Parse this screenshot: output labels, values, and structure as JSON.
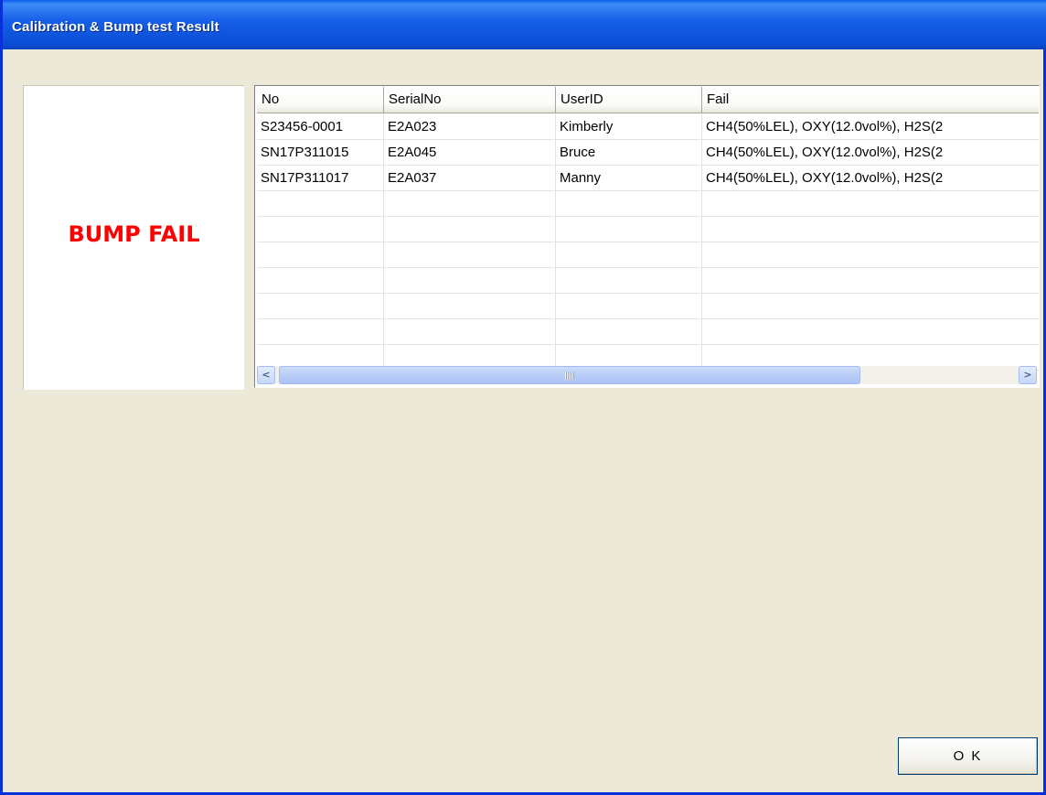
{
  "window": {
    "title": "Calibration & Bump test Result"
  },
  "status": {
    "label": "BUMP FAIL",
    "color": "#FF0000"
  },
  "table": {
    "columns": [
      "No",
      "SerialNo",
      "UserID",
      "Fail"
    ],
    "rows": [
      [
        "S23456-0001",
        "E2A023",
        "Kimberly",
        "CH4(50%LEL), OXY(12.0vol%), H2S(2"
      ],
      [
        "SN17P311015",
        "E2A045",
        "Bruce",
        "CH4(50%LEL), OXY(12.0vol%), H2S(2"
      ],
      [
        "SN17P311017",
        "E2A037",
        "Manny",
        "CH4(50%LEL), OXY(12.0vol%), H2S(2"
      ],
      [
        "",
        "",
        "",
        ""
      ],
      [
        "",
        "",
        "",
        ""
      ],
      [
        "",
        "",
        "",
        ""
      ],
      [
        "",
        "",
        "",
        ""
      ],
      [
        "",
        "",
        "",
        ""
      ],
      [
        "",
        "",
        "",
        ""
      ],
      [
        "",
        "",
        "",
        ""
      ]
    ]
  },
  "scrollbar": {
    "left_arrow": "<",
    "right_arrow": ">"
  },
  "buttons": {
    "ok_label": "O K"
  }
}
